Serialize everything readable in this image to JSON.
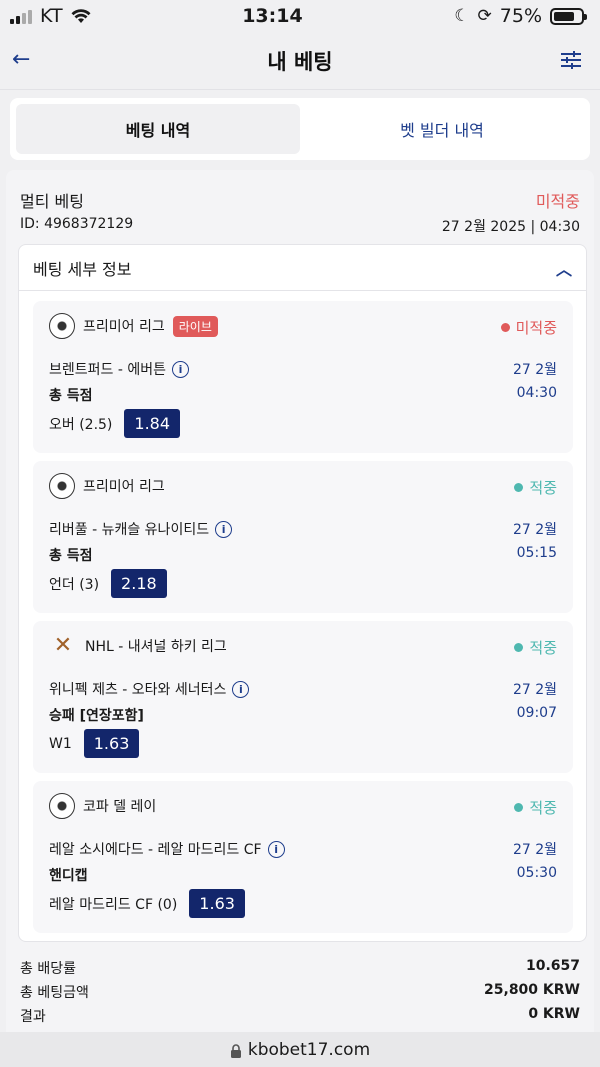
{
  "status": {
    "carrier": "KT",
    "time": "13:14",
    "battery": "75%",
    "battery_level": 0.75
  },
  "header": {
    "title": "내 베팅",
    "back_icon": "arrow-left",
    "filter_icon": "sliders"
  },
  "tabs": [
    {
      "label": "베팅 내역",
      "active": true
    },
    {
      "label": "벳 빌더 내역",
      "active": false
    }
  ],
  "bet": {
    "type": "멀티 베팅",
    "status": "미적중",
    "id": "ID: 4968372129",
    "datetime": "27 2월 2025 | 04:30",
    "details_label": "베팅 세부 정보",
    "selections": [
      {
        "league": "프리미어 리그",
        "live": "라이브",
        "status": "미적중",
        "status_color": "#e05a5a",
        "match": "브렌트퍼드 - 에버튼",
        "market": "총 득점",
        "date": "27 2월",
        "time": "04:30",
        "pick": "오버 (2.5)",
        "odds": "1.84",
        "icon": "soccer-ball"
      },
      {
        "league": "프리미어 리그",
        "live": "",
        "status": "적중",
        "status_color": "#4fb8b0",
        "match": "리버풀 - 뉴캐슬 유나이티드",
        "market": "총 득점",
        "date": "27 2월",
        "time": "05:15",
        "pick": "언더 (3)",
        "odds": "2.18",
        "icon": "soccer-ball"
      },
      {
        "league": "NHL - 내셔널 하키 리그",
        "live": "",
        "status": "적중",
        "status_color": "#4fb8b0",
        "match": "위니펙 제츠 - 오타와 세너터스",
        "market": "승패 [연장포함]",
        "date": "27 2월",
        "time": "09:07",
        "pick": "W1",
        "odds": "1.63",
        "icon": "hockey-sticks"
      },
      {
        "league": "코파 델 레이",
        "live": "",
        "status": "적중",
        "status_color": "#4fb8b0",
        "match": "레알 소시에다드 - 레알 마드리드 CF",
        "market": "핸디캡",
        "date": "27 2월",
        "time": "05:30",
        "pick": "레알 마드리드 CF (0)",
        "odds": "1.63",
        "icon": "soccer-ball"
      }
    ],
    "summary": [
      {
        "label": "총 배당률",
        "value": "10.657"
      },
      {
        "label": "총 베팅금액",
        "value": "25,800 KRW"
      },
      {
        "label": "결과",
        "value": "0 KRW"
      }
    ]
  },
  "url": "kbobet17.com"
}
